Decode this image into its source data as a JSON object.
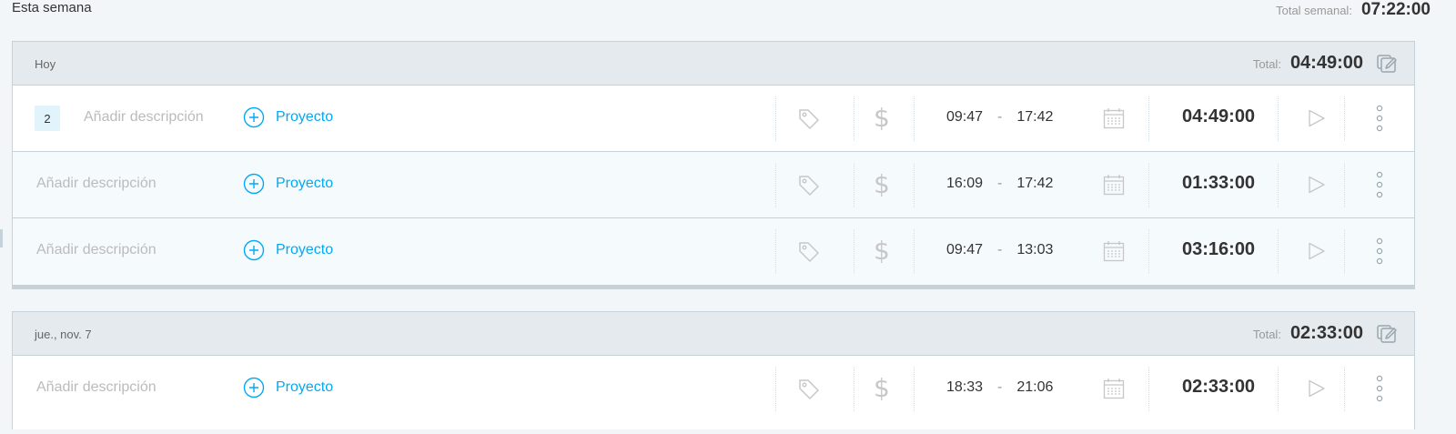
{
  "week": {
    "title": "Esta semana",
    "total_label": "Total semanal:",
    "total_value": "07:22:00"
  },
  "colors": {
    "accent": "#03a9f4",
    "page_bg": "#f2f6f8",
    "group_header_bg": "#e4eaee",
    "alt_row_bg": "#f5fafd",
    "placeholder": "#bbbbbb",
    "icon_gray": "#c7c7c7"
  },
  "icons": {
    "bulk_edit": "bulk-edit-icon",
    "project_add": "plus-circle-icon",
    "tag": "tag-icon",
    "billable": "dollar-icon",
    "calendar": "calendar-icon",
    "start": "play-icon",
    "more": "more-vertical-icon"
  },
  "groups": [
    {
      "date": "Hoy",
      "total_label": "Total:",
      "total_value": "04:49:00",
      "entries": [
        {
          "count": "2",
          "description_placeholder": "Añadir descripción",
          "project_label": "Proyecto",
          "billable_symbol": "$",
          "start": "09:47",
          "dash": "-",
          "end": "17:42",
          "duration": "04:49:00"
        },
        {
          "description_placeholder": "Añadir descripción",
          "project_label": "Proyecto",
          "billable_symbol": "$",
          "start": "16:09",
          "dash": "-",
          "end": "17:42",
          "duration": "01:33:00"
        },
        {
          "description_placeholder": "Añadir descripción",
          "project_label": "Proyecto",
          "billable_symbol": "$",
          "start": "09:47",
          "dash": "-",
          "end": "13:03",
          "duration": "03:16:00"
        }
      ]
    },
    {
      "date": "jue., nov. 7",
      "total_label": "Total:",
      "total_value": "02:33:00",
      "entries": [
        {
          "description_placeholder": "Añadir descripción",
          "project_label": "Proyecto",
          "billable_symbol": "$",
          "start": "18:33",
          "dash": "-",
          "end": "21:06",
          "duration": "02:33:00"
        }
      ]
    }
  ]
}
